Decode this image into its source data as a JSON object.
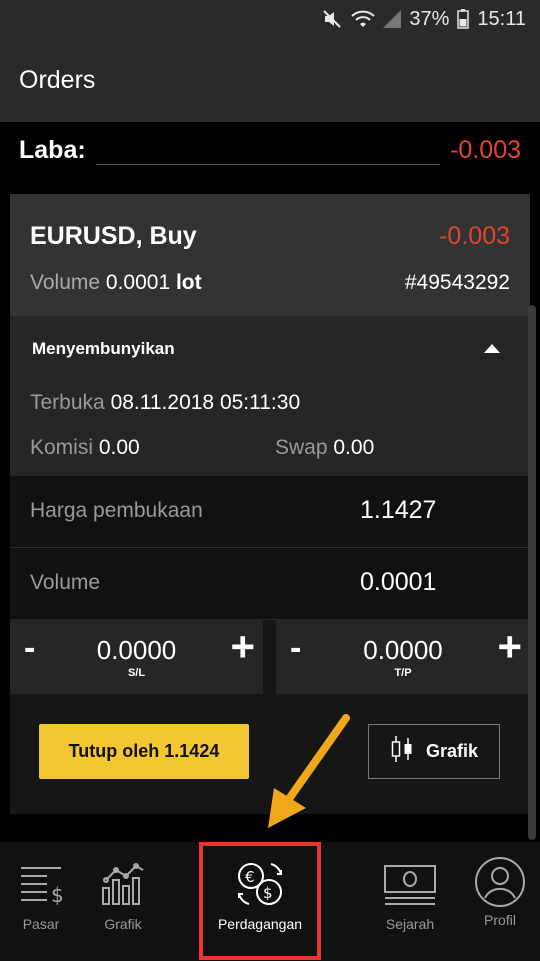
{
  "status": {
    "battery": "37%",
    "time": "15:11"
  },
  "appbar": {
    "title": "Orders"
  },
  "summary": {
    "label": "Laba:",
    "value": "-0.003"
  },
  "order": {
    "symbol": "EURUSD, Buy",
    "profit": "-0.003",
    "volume_label": "Volume",
    "volume_value": "0.0001",
    "volume_unit": "lot",
    "ticket": "#49543292",
    "hide_label": "Menyembunyikan",
    "open_label": "Terbuka",
    "open_time": "08.11.2018 05:11:30",
    "commission_label": "Komisi",
    "commission_value": "0.00",
    "swap_label": "Swap",
    "swap_value": "0.00",
    "open_price_label": "Harga pembukaan",
    "open_price_value": "1.1427",
    "vol_field_label": "Volume",
    "vol_field_value": "0.0001",
    "sl": {
      "minus": "-",
      "value": "0.0000",
      "plus": "+",
      "caption": "S/L"
    },
    "tp": {
      "minus": "-",
      "value": "0.0000",
      "plus": "+",
      "caption": "T/P"
    },
    "close_button": "Tutup oleh 1.1424",
    "chart_button": "Grafik"
  },
  "nav": {
    "items": [
      {
        "label": "Pasar",
        "icon": "market-icon"
      },
      {
        "label": "Grafik",
        "icon": "chart-icon"
      },
      {
        "label": "Perdagangan",
        "icon": "trading-icon"
      },
      {
        "label": "Sejarah",
        "icon": "history-icon"
      },
      {
        "label": "Profil",
        "icon": "profile-icon"
      }
    ]
  },
  "colors": {
    "negative": "#e2452f",
    "accent": "#f3c731",
    "highlight": "#ee3333",
    "arrow": "#f0a818"
  }
}
